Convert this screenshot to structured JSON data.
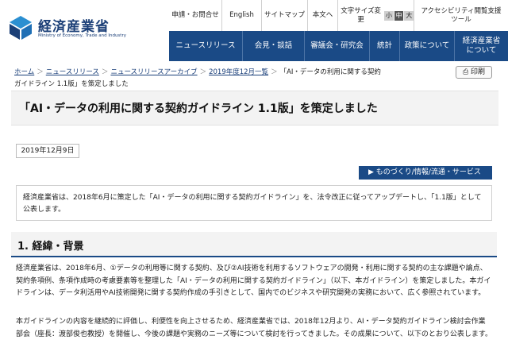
{
  "header": {
    "logo_title": "経済産業省",
    "logo_sub": "Ministry of Economy, Trade and Industry"
  },
  "util": {
    "items": [
      "申請・お問合せ",
      "English",
      "サイトマップ",
      "本文へ",
      "文字サイズ変更",
      "アクセシビリティ閲覧支援ツール"
    ],
    "font_sizes": [
      "小",
      "中",
      "大"
    ]
  },
  "nav": {
    "items": [
      "ニュースリリース",
      "会見・談話",
      "審議会・研究会",
      "統計",
      "政策について",
      "経済産業省について"
    ]
  },
  "breadcrumb": {
    "items": [
      "ホーム",
      "ニュースリリース",
      "ニュースリリースアーカイブ",
      "2019年度12月一覧"
    ],
    "current": "「AI・データの利用に関する契約ガイドライン 1.1版」を策定しました",
    "separator": "＞"
  },
  "print_label": "印刷",
  "page_title": "「AI・データの利用に関する契約ガイドライン 1.1版」を策定しました",
  "date": "2019年12月9日",
  "tag": "ものづくり/情報/流通・サービス",
  "summary": "経済産業省は、2018年6月に策定した「AI・データの利用に関する契約ガイドライン」を、法令改正に従ってアップデートし、「1.1版」として公表します。",
  "section1": {
    "heading": "1. 経緯・背景",
    "p1": "経済産業省は、2018年6月、①データの利用等に関する契約、及び②AI技術を利用するソフトウェアの開発・利用に関する契約の主な課題や論点、契約条項例、条項作成時の考慮要素等を整理した「AI・データの利用に関する契約ガイドライン」（以下、本ガイドライン）を策定しました。本ガイドラインは、データ利活用やAI技術開発に関する契約作成の手引きとして、国内でのビジネスや研究開発の実務において、広く参照されています。",
    "p2": "本ガイドラインの内容を継続的に評価し、利便性を向上させるため、経済産業省では、2018年12月より、AI・データ契約ガイドライン検討会作業部会（座長：渡部俊也教授）を開催し、今後の課題や実務のニーズ等について検討を行ってきました。その成果について、以下のとおり公表します。"
  },
  "colors": {
    "nav_bg": "#1a4a86",
    "brand": "#1b3f77"
  }
}
